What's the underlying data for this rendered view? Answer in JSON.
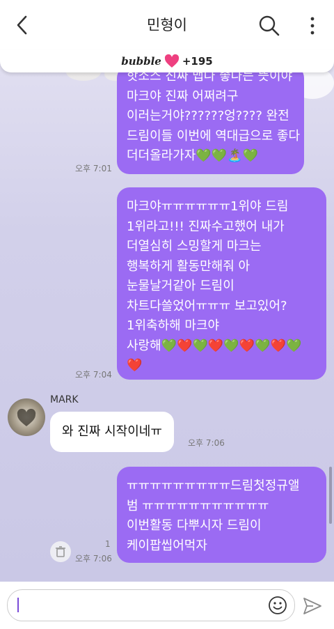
{
  "header": {
    "title": "민형이",
    "back_icon": "chevron-left-icon",
    "search_icon": "search-icon",
    "more_icon": "more-vertical-icon"
  },
  "bubble_bar": {
    "logo": "bubble",
    "count": "+195",
    "heart_color": "#ee4080"
  },
  "messages": [
    {
      "text": "핫소스 진짜 맵나 좋나는 뜻이야\n마크야 진짜 어쩌려구\n이러는거야??????엉???? 완전\n드림이들 이번에 역대급으로 좋다\n더더올라가자💚💚🏝️💚",
      "time": "오후 7:01"
    },
    {
      "text": "마크야ㅠㅠㅠㅠㅠㅠ1위야 드림\n1위라고!!! 진짜수고했어 내가\n더열심히 스밍할게 마크는\n행복하게 활동만해줘 아\n눈물날거같아 드림이\n차트다쓸었어ㅠㅠㅠ 보고있어?\n1위축하해 마크야\n사랑해💚❤️💚❤️💚❤️💚❤️💚\n❤️",
      "time": "오후 7:04"
    },
    {
      "text": "ㅠㅠㅠㅠㅠㅠㅠㅠㅠ드림첫정규앨\n범 ㅠㅠㅠㅠㅠㅠㅠㅠㅠㅠㅠ\n이번활동 다뿌시자 드림이\n케이팝씹어먹자",
      "time": "오후 7:06",
      "unread": "1"
    }
  ],
  "reply": {
    "sender": "MARK",
    "text": "와 진짜 시작이네ㅠ",
    "time": "오후 7:06"
  },
  "composer": {
    "placeholder": "",
    "emoji_icon": "smiley-icon",
    "send_icon": "send-icon"
  },
  "colors": {
    "accent": "#9b6bf3",
    "background": "#d2d0ea"
  }
}
